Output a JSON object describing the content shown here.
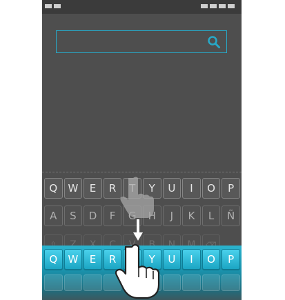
{
  "search": {
    "placeholder": "",
    "icon": "search-icon",
    "accent": "#27a9c8"
  },
  "status_bar": {
    "left_indicators": 2,
    "right_indicators": 4
  },
  "keyboard": {
    "row1": [
      "Q",
      "W",
      "E",
      "R",
      "T",
      "Y",
      "U",
      "I",
      "O",
      "P"
    ],
    "row2": [
      "A",
      "S",
      "D",
      "F",
      "G",
      "H",
      "J",
      "K",
      "L",
      "Ñ"
    ],
    "row3": [
      "⇧",
      "Z",
      "X",
      "C",
      "V",
      "B",
      "N",
      "M",
      "⌫"
    ],
    "colors": {
      "dark_key": "#585858",
      "accent_key": "#29b2cf"
    }
  },
  "gesture": {
    "drag_arrow": "down-arrow-icon",
    "hands": [
      "hand-pointer-icon-faded",
      "hand-pointer-icon"
    ]
  }
}
